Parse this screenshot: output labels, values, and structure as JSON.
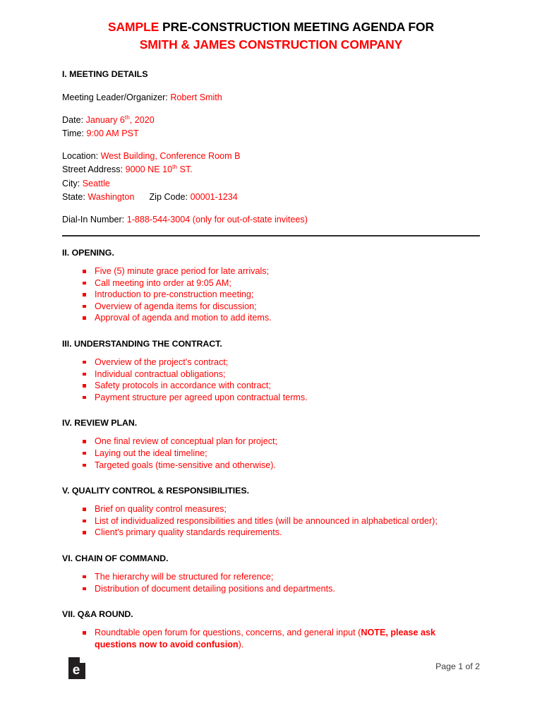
{
  "title": {
    "line1_red": "SAMPLE",
    "line1_black": " PRE-CONSTRUCTION MEETING AGENDA FOR",
    "line2": "SMITH & JAMES CONSTRUCTION COMPANY"
  },
  "colors": {
    "accent_red": "#FF0000",
    "text_black": "#000000",
    "divider": "#2b2b2b"
  },
  "sections": {
    "s1": {
      "heading": "I. MEETING DETAILS",
      "organizer_label": "Meeting Leader/Organizer: ",
      "organizer_value": "Robert Smith",
      "date_label": "Date: ",
      "date_value_pre": "January 6",
      "date_value_sup": "th",
      "date_value_post": ", 2020",
      "time_label": "Time: ",
      "time_value": "9:00 AM PST",
      "location_label": "Location: ",
      "location_value": "West Building, Conference Room B",
      "street_label": "Street Address: ",
      "street_value_pre": "9000 NE 10",
      "street_value_sup": "th",
      "street_value_post": " ST.",
      "city_label": "City: ",
      "city_value": "Seattle",
      "state_label": "State: ",
      "state_value": "Washington",
      "zip_label": "Zip Code: ",
      "zip_value": "00001-1234",
      "dialin_label": "Dial-In Number: ",
      "dialin_value": "1-888-544-3004 (only for out-of-state invitees)"
    },
    "s2": {
      "heading": "II. OPENING",
      "heading_period": ".",
      "bullets": [
        "Five (5) minute grace period for late arrivals;",
        "Call meeting into order at 9:05 AM;",
        "Introduction to pre-construction meeting;",
        "Overview of agenda items for discussion;",
        "Approval of agenda and motion to add items."
      ]
    },
    "s3": {
      "heading": "III. UNDERSTANDING THE CONTRACT",
      "heading_period": ".",
      "bullets": [
        "Overview of the project's contract;",
        "Individual contractual obligations;",
        "Safety protocols in accordance with contract;",
        "Payment structure per agreed upon contractual terms."
      ]
    },
    "s4": {
      "heading": "IV. REVIEW PLAN.",
      "bullets": [
        "One final review of conceptual plan for project;",
        "Laying out the ideal timeline;",
        "Targeted goals (time-sensitive and otherwise)."
      ]
    },
    "s5": {
      "heading": "V. QUALITY CONTROL & RESPONSIBILITIES",
      "heading_period": ".",
      "bullets": [
        "Brief on quality control measures;",
        "List of individualized responsibilities and titles (will be announced in alphabetical order);",
        "Client's primary quality standards requirements."
      ]
    },
    "s6": {
      "heading": "VI. CHAIN OF COMMAND",
      "heading_period": ".",
      "bullets": [
        "The hierarchy will be structured for reference;",
        "Distribution of document detailing positions and departments."
      ]
    },
    "s7": {
      "heading": "VII. Q&A ROUND",
      "heading_period": ".",
      "qa_text_pre": "Roundtable open forum for questions, concerns, and general input (",
      "qa_text_bold": "NOTE, please ask questions now to avoid confusion",
      "qa_text_post": ")."
    }
  },
  "footer": {
    "logo_glyph": "e",
    "logo_name": "eforms-document-logo",
    "page_number": "Page 1 of 2"
  }
}
